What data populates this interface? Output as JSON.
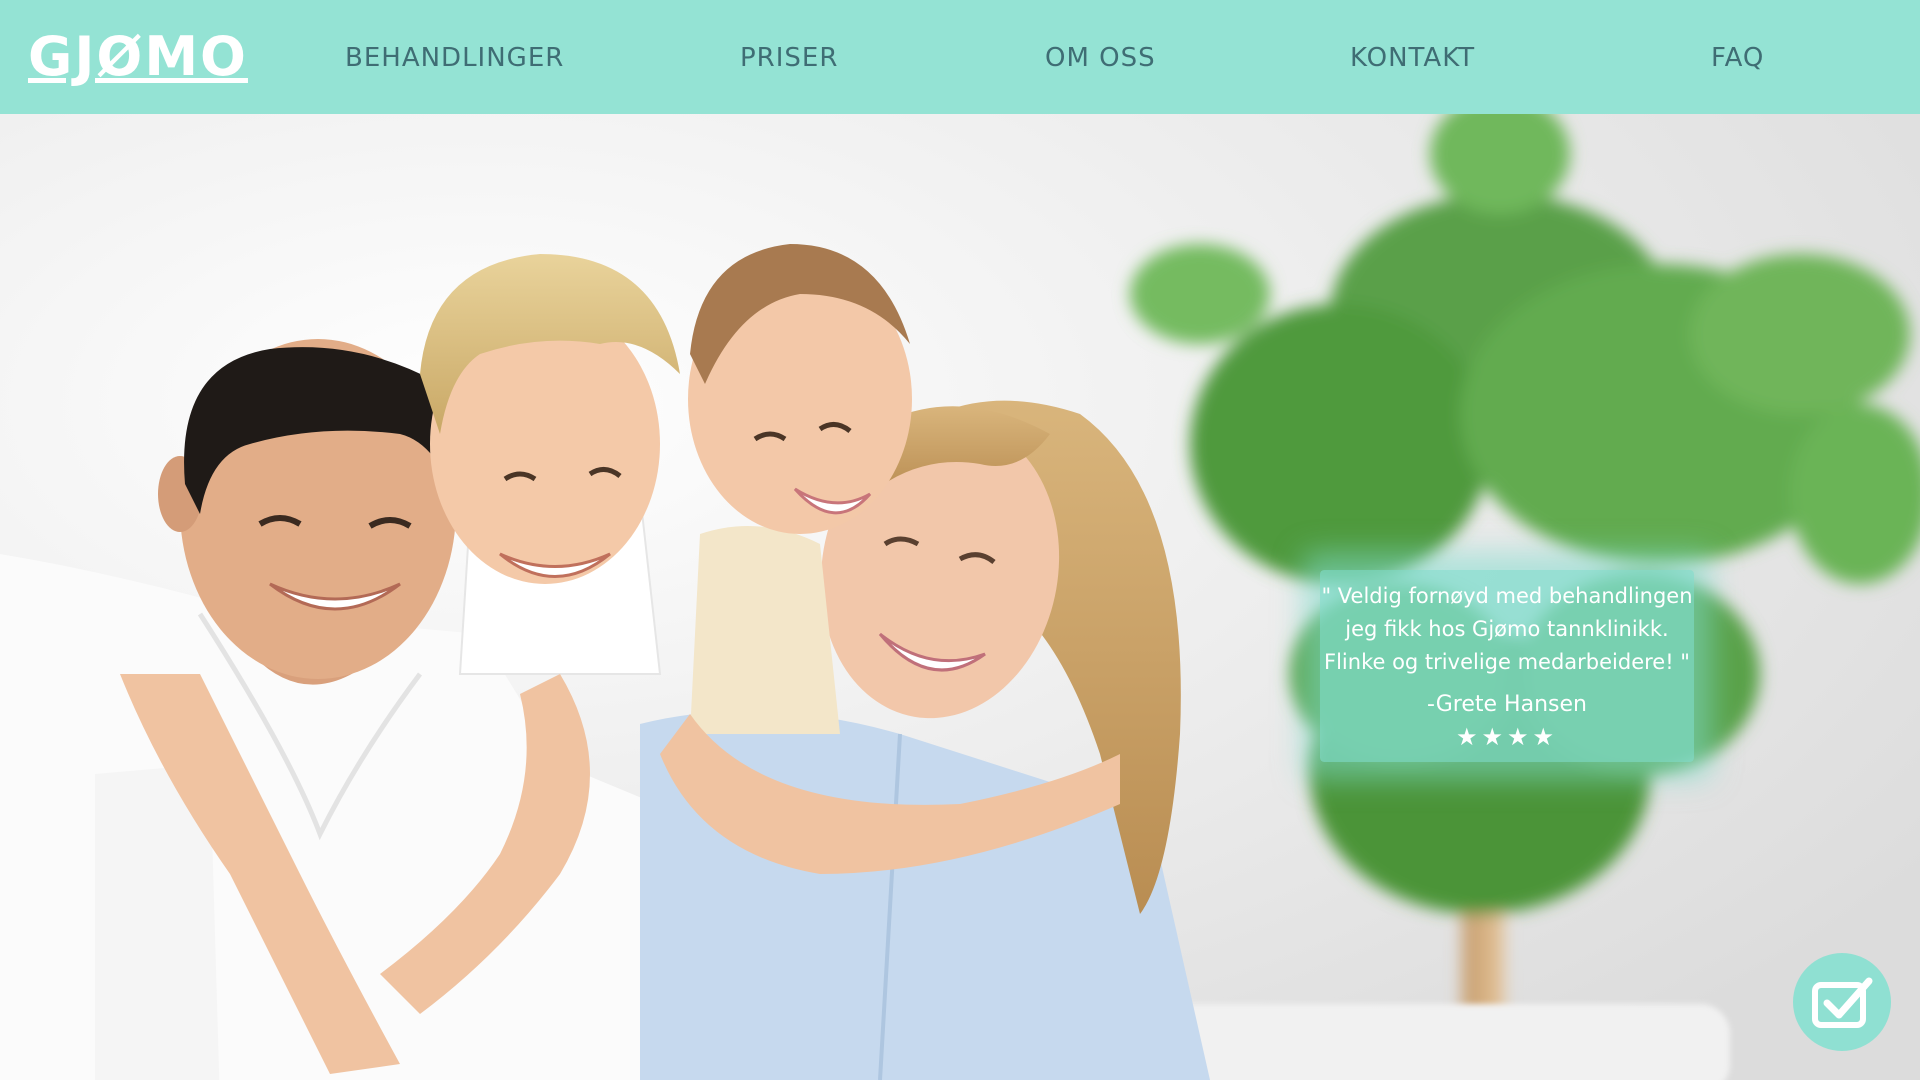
{
  "header": {
    "logo_text": "GJØMO",
    "nav": [
      {
        "label": "BEHANDLINGER"
      },
      {
        "label": "PRISER"
      },
      {
        "label": "OM OSS"
      },
      {
        "label": "KONTAKT"
      },
      {
        "label": "FAQ"
      }
    ]
  },
  "hero": {
    "photo_icon": "family-photo",
    "testimonial": {
      "lines": [
        "\" Veldig fornøyd med behandlingen",
        "jeg fikk hos Gjømo tannklinikk.",
        "Flinke og trivelige medarbeidere! \""
      ],
      "author": "-Grete Hansen",
      "stars": "★★★★",
      "rating": 4
    }
  },
  "floating_button": {
    "icon": "checkbox-check-icon"
  },
  "colors": {
    "header_bg": "#94e3d4",
    "nav_text": "#3f6d74",
    "accent": "#8fe0d2",
    "testimonial_bg": "#80dccd",
    "white": "#ffffff"
  }
}
